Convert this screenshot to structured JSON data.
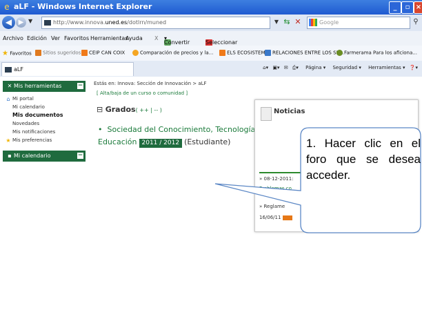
{
  "window": {
    "title": "aLF - Windows Internet Explorer"
  },
  "address_bar": {
    "url_prefix": "http://www.innova.",
    "url_domain": "uned.es",
    "url_suffix": "/dotlrn/muned",
    "search_placeholder": "Google"
  },
  "menu": {
    "items": [
      "Archivo",
      "Edición",
      "Ver",
      "Favoritos",
      "Herramientas",
      "Ayuda"
    ],
    "convert_label": "Convertir",
    "select_label": "Seleccionar"
  },
  "favorites_bar": {
    "favorites_label": "Favoritos",
    "items": [
      "Sitios sugeridos",
      "CEIP CAN COIX",
      "Comparación de precios y la...",
      "ELS ECOSISTEMES",
      "RELACIONES ENTRE LOS SE...",
      "Farmerama Para los aficiona..."
    ]
  },
  "tab": {
    "label": "aLF"
  },
  "command_bar": {
    "page_label": "Página",
    "security_label": "Seguridad",
    "tools_label": "Herramientas"
  },
  "sidebar": {
    "tools_header": "Mis herramientas",
    "items": [
      {
        "label": "Mi portal",
        "bold": false
      },
      {
        "label": "Mi calendario",
        "bold": false
      },
      {
        "label": "Mis documentos",
        "bold": true
      },
      {
        "label": "Novedades",
        "bold": false
      },
      {
        "label": "Mis notificaciones",
        "bold": false
      },
      {
        "label": "Mis preferencias",
        "bold": false
      }
    ],
    "calendar_header": "Mi calendario"
  },
  "main": {
    "breadcrumb": "Estás en: Innova: Sección de Innovación > aLF",
    "alta_link": "[ Alta/baja de un curso o comunidad ]",
    "grados_label": "Grados",
    "grados_controls": "( ++ | -- )",
    "course_line1": "Sociedad del Conocimiento, Tecnología y",
    "course_line2": "Educación",
    "course_year": "2011 / 2012",
    "course_role": "(Estudiante)"
  },
  "news": {
    "title": "Noticias",
    "item1": "» 08-12-2011:",
    "item2": "Problemas co",
    "item3": "» Reglame",
    "item4": "16/06/11"
  },
  "callout": {
    "text": "1. Hacer clic en el foro que se desea acceder."
  },
  "colors": {
    "title_bar": "#2a6ad8",
    "sidebar_header": "#1f6b3e",
    "link_green": "#1a7a3a",
    "year_badge": "#1f6b3e"
  }
}
